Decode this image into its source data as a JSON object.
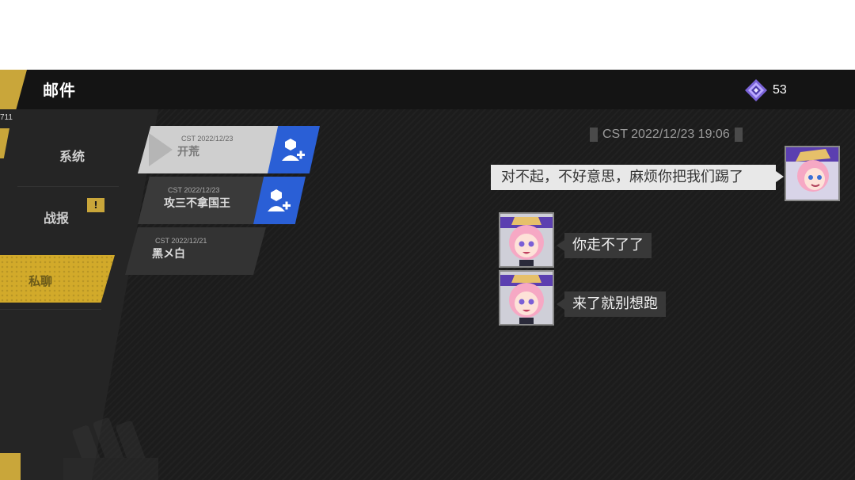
{
  "header": {
    "title": "邮件",
    "currency": {
      "icon": "diamond-crystal-icon",
      "value": "53"
    }
  },
  "edge": {
    "partial_text": "711"
  },
  "sidebar": {
    "categories": [
      {
        "label": "系统",
        "active": false
      },
      {
        "label": "战报",
        "active": false,
        "badge": "!"
      },
      {
        "label": "私聊",
        "active": true
      }
    ]
  },
  "mail_list": [
    {
      "date": "CST 2022/12/23",
      "sender": "开荒",
      "selected": true,
      "add_friend_icon": "add-friend-icon"
    },
    {
      "date": "CST 2022/12/23",
      "sender": "攻三不拿国王",
      "selected": false,
      "add_friend_icon": "add-friend-icon"
    },
    {
      "date": "CST 2022/12/21",
      "sender": "黑メ白",
      "selected": false
    }
  ],
  "chat": {
    "timestamp": "CST 2022/12/23 19:06",
    "messages": [
      {
        "from": "me",
        "text": "对不起，不好意思，麻烦你把我们踢了"
      },
      {
        "from": "other",
        "text": "你走不了了"
      },
      {
        "from": "other",
        "text": "来了就别想跑"
      }
    ]
  },
  "colors": {
    "accent_gold": "#c9a63a",
    "active_tab": "#d2aa2a",
    "add_friend_blue": "#2a5fd6",
    "background": "#1c1c1c"
  }
}
